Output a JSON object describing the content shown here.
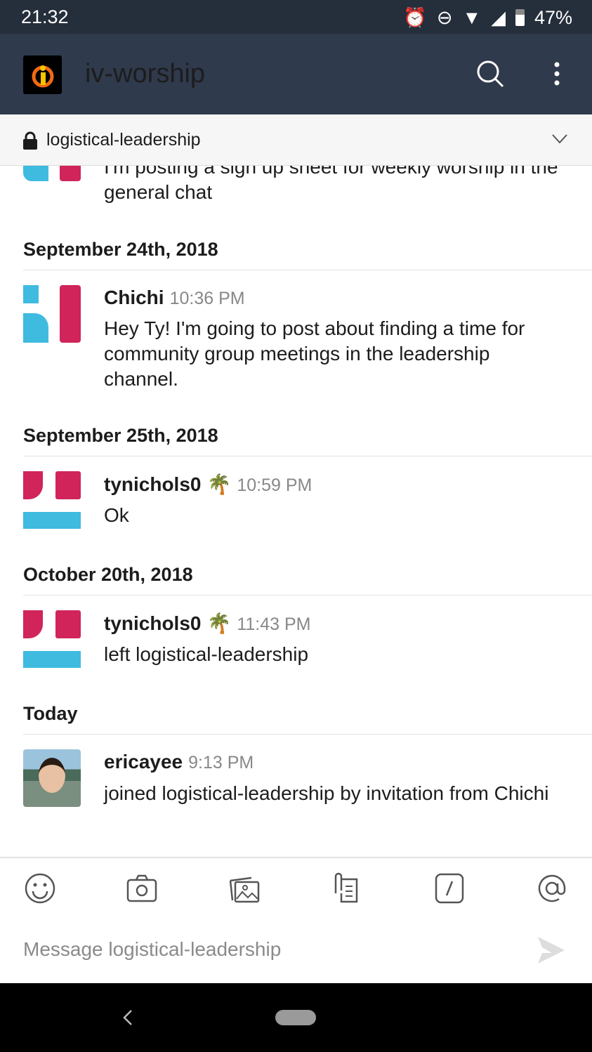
{
  "status_bar": {
    "time": "21:32",
    "battery": "47%"
  },
  "app_bar": {
    "workspace": "iv-worship"
  },
  "channel": {
    "name": "logistical-leadership"
  },
  "messages": [
    {
      "text": "I'm posting a sign up sheet for weekly worship in the general chat"
    },
    {
      "date": "September 24th, 2018",
      "author": "Chichi",
      "time": "10:36 PM",
      "text": "Hey Ty! I'm going to post about finding a time for community group meetings in the leadership channel."
    },
    {
      "date": "September 25th, 2018",
      "author": "tynichols0",
      "emoji": "🌴",
      "time": "10:59 PM",
      "text": "Ok"
    },
    {
      "date": "October 20th, 2018",
      "author": "tynichols0",
      "emoji": "🌴",
      "time": "11:43 PM",
      "text": "left logistical-leadership"
    },
    {
      "date": "Today",
      "author": "ericayee",
      "time": "9:13 PM",
      "text": "joined logistical-leadership by invitation from Chichi"
    }
  ],
  "composer": {
    "placeholder": "Message logistical-leadership"
  },
  "colors": {
    "blue": "#3fbbe0",
    "red": "#d0245a",
    "header": "#2f3a4c"
  }
}
